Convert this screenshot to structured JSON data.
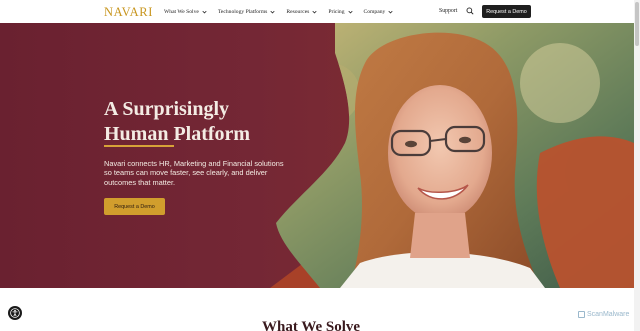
{
  "brand": {
    "logo_text": "NAVARI",
    "accent": "#c8961f"
  },
  "nav": {
    "items": [
      {
        "label": "What We Solve"
      },
      {
        "label": "Technology Platforms"
      },
      {
        "label": "Resources"
      },
      {
        "label": "Pricing"
      },
      {
        "label": "Company"
      }
    ],
    "support_label": "Support",
    "search_icon": "search-icon",
    "cta_label": "Request a Demo"
  },
  "hero": {
    "title_line1": "A Surprisingly",
    "title_line2": "Human Platform",
    "description": "Navari connects HR, Marketing and Financial solutions so teams can move faster, see clearly, and deliver outcomes that matter.",
    "cta_label": "Request a Demo",
    "colors": {
      "background": "#6b2330",
      "button": "#d19e2d",
      "underline": "#d7a238"
    }
  },
  "next_section": {
    "heading": "What We Solve"
  },
  "accessibility": {
    "icon": "accessibility-icon"
  },
  "watermark": {
    "text": "ScanMalware"
  }
}
